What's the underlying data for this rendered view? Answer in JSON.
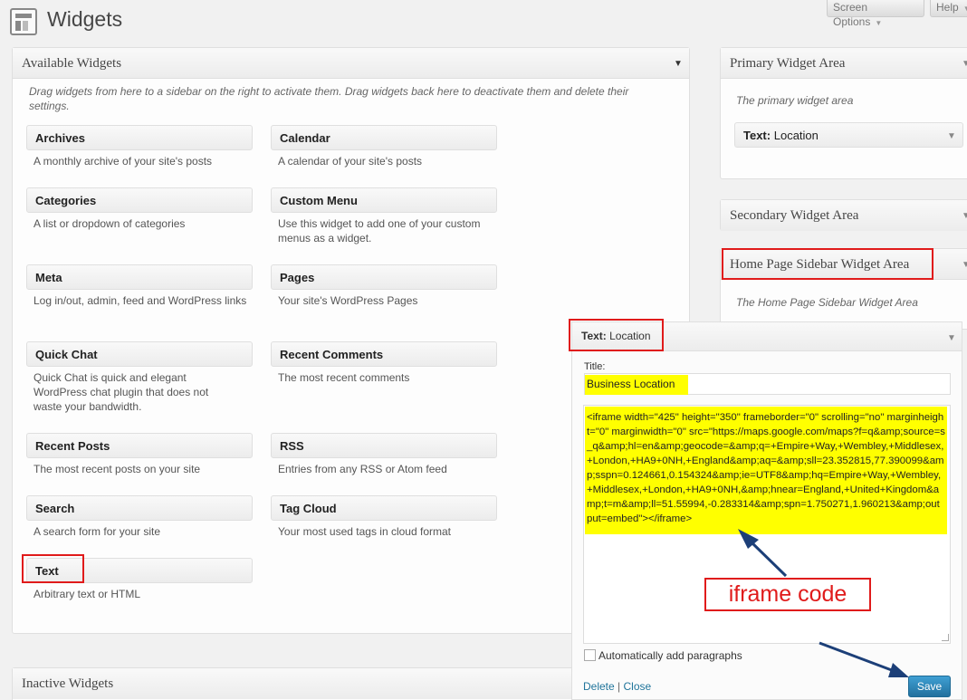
{
  "header": {
    "title": "Widgets",
    "screen_options": "Screen Options",
    "help": "Help"
  },
  "available": {
    "title": "Available Widgets",
    "description": "Drag widgets from here to a sidebar on the right to activate them. Drag widgets back here to deactivate them and delete their settings.",
    "widgets": [
      {
        "title": "Archives",
        "desc": "A monthly archive of your site's posts"
      },
      {
        "title": "Calendar",
        "desc": "A calendar of your site's posts"
      },
      {
        "title": "Categories",
        "desc": "A list or dropdown of categories"
      },
      {
        "title": "Custom Menu",
        "desc": "Use this widget to add one of your custom menus as a widget."
      },
      {
        "title": "Meta",
        "desc": "Log in/out, admin, feed and WordPress links"
      },
      {
        "title": "Pages",
        "desc": "Your site's WordPress Pages"
      },
      {
        "title": "Quick Chat",
        "desc": "Quick Chat is quick and elegant WordPress chat plugin that does not waste your bandwidth."
      },
      {
        "title": "Recent Comments",
        "desc": "The most recent comments"
      },
      {
        "title": "Recent Posts",
        "desc": "The most recent posts on your site"
      },
      {
        "title": "RSS",
        "desc": "Entries from any RSS or Atom feed"
      },
      {
        "title": "Search",
        "desc": "A search form for your site"
      },
      {
        "title": "Tag Cloud",
        "desc": "Your most used tags in cloud format"
      },
      {
        "title": "Text",
        "desc": "Arbitrary text or HTML"
      }
    ]
  },
  "inactive": {
    "title": "Inactive Widgets"
  },
  "sidebars": {
    "primary": {
      "title": "Primary Widget Area",
      "description": "The primary widget area",
      "widget_prefix": "Text:",
      "widget_name": "Location"
    },
    "secondary": {
      "title": "Secondary Widget Area"
    },
    "home": {
      "title": "Home Page Sidebar Widget Area",
      "description": "The Home Page Sidebar Widget Area"
    }
  },
  "text_widget": {
    "prefix": "Text:",
    "name": "Location",
    "title_label": "Title:",
    "title_value": "Business Location",
    "code": "<iframe width=\"425\" height=\"350\" frameborder=\"0\" scrolling=\"no\" marginheight=\"0\" marginwidth=\"0\" src=\"https://maps.google.com/maps?f=q&amp;source=s_q&amp;hl=en&amp;geocode=&amp;q=+Empire+Way,+Wembley,+Middlesex,+London,+HA9+0NH,+England&amp;aq=&amp;sll=23.352815,77.390099&amp;sspn=0.124661,0.154324&amp;ie=UTF8&amp;hq=Empire+Way,+Wembley,+Middlesex,+London,+HA9+0NH,&amp;hnear=England,+United+Kingdom&amp;t=m&amp;ll=51.55994,-0.283314&amp;spn=1.750271,1.960213&amp;output=embed\"></iframe>",
    "auto_paragraphs": "Automatically add paragraphs",
    "delete": "Delete",
    "separator": "|",
    "close": "Close",
    "save": "Save"
  },
  "annotation": {
    "label": "iframe code"
  },
  "colors": {
    "highlight": "#ffff00",
    "annotation_red": "#e01b1b",
    "arrow_blue": "#1c3f78",
    "link": "#21759b"
  },
  "icons": {
    "header": "widgets-icon",
    "toggle": "triangle-down-icon",
    "annotation": "arrow-icon"
  }
}
